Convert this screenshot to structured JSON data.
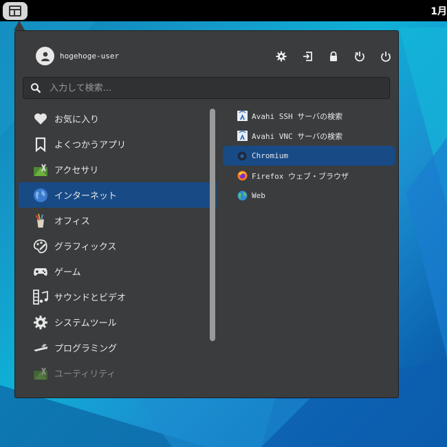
{
  "topbar": {
    "clock": "1月"
  },
  "user": {
    "name": "hogehoge-user"
  },
  "actions": [
    {
      "icon": "gear-icon",
      "label": "settings"
    },
    {
      "icon": "logout-icon",
      "label": "logout"
    },
    {
      "icon": "lock-icon",
      "label": "lock"
    },
    {
      "icon": "restart-icon",
      "label": "restart"
    },
    {
      "icon": "power-icon",
      "label": "shutdown"
    }
  ],
  "search": {
    "placeholder": "入力して検索..."
  },
  "categories": [
    {
      "label": "お気に入り",
      "icon": "heart-icon"
    },
    {
      "label": "よくつかうアプリ",
      "icon": "bookmark-icon"
    },
    {
      "label": "アクセサリ",
      "icon": "accessories-icon"
    },
    {
      "label": "インターネット",
      "icon": "globe-icon"
    },
    {
      "label": "オフィス",
      "icon": "office-icon"
    },
    {
      "label": "グラフィックス",
      "icon": "palette-icon"
    },
    {
      "label": "ゲーム",
      "icon": "gamepad-icon"
    },
    {
      "label": "サウンドとビデオ",
      "icon": "media-icon"
    },
    {
      "label": "システムツール",
      "icon": "system-gear-icon"
    },
    {
      "label": "プログラミング",
      "icon": "programming-icon"
    },
    {
      "label": "ユーティリティ",
      "icon": "utilities-icon"
    }
  ],
  "apps": [
    {
      "label": "Avahi SSH サーバの検索",
      "icon": "avahi-icon"
    },
    {
      "label": "Avahi VNC サーバの検索",
      "icon": "avahi-icon"
    },
    {
      "label": "Chromium",
      "icon": "chromium-icon"
    },
    {
      "label": "Firefox ウェブ・ブラウザ",
      "icon": "firefox-icon"
    },
    {
      "label": "Web",
      "icon": "web-globe-icon"
    }
  ],
  "colors": {
    "panel": "#3a3c3d",
    "selection": "#184a86",
    "topbar": "#000000"
  }
}
